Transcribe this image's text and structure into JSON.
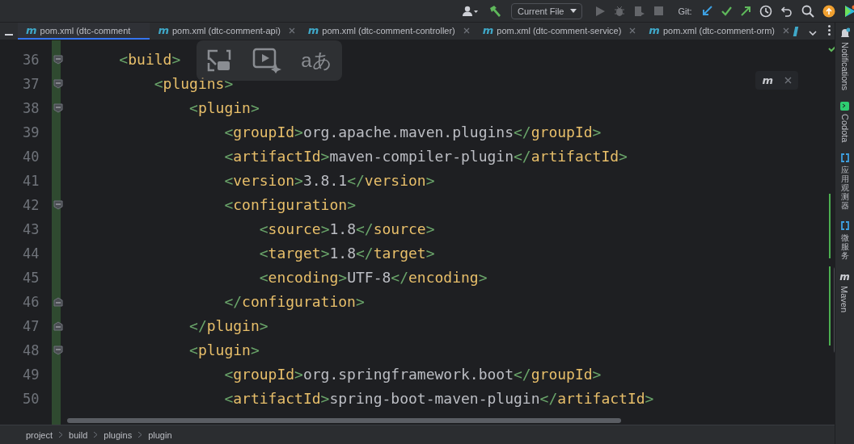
{
  "toolbar": {
    "run_config": "Current File",
    "run_actions_disabled": true,
    "git_label": "Git:"
  },
  "tabs": [
    {
      "icon": "m",
      "label": "pom.xml (dtc-comment",
      "selected": true
    },
    {
      "icon": "m",
      "label": "pom.xml (dtc-comment-api)",
      "selected": false
    },
    {
      "icon": "m",
      "label": "pom.xml (dtc-comment-controller)",
      "selected": false
    },
    {
      "icon": "m",
      "label": "pom.xml (dtc-comment-service)",
      "selected": false
    },
    {
      "icon": "m",
      "label": "pom.xml (dtc-comment-orm)",
      "selected": false
    }
  ],
  "overlay": {
    "translate_glyph": "aあ"
  },
  "maven_popup": {
    "icon": "m"
  },
  "editor": {
    "lines": [
      {
        "number": "36",
        "code": "    <build>",
        "fold_open": true,
        "fold_close": false
      },
      {
        "number": "37",
        "code": "        <plugins>",
        "fold_open": true,
        "fold_close": false
      },
      {
        "number": "38",
        "code": "            <plugin>",
        "fold_open": true,
        "fold_close": false
      },
      {
        "number": "39",
        "code": "                <groupId>org.apache.maven.plugins</groupId>",
        "fold_open": false,
        "fold_close": false
      },
      {
        "number": "40",
        "code": "                <artifactId>maven-compiler-plugin</artifactId>",
        "fold_open": false,
        "fold_close": false
      },
      {
        "number": "41",
        "code": "                <version>3.8.1</version>",
        "fold_open": false,
        "fold_close": false
      },
      {
        "number": "42",
        "code": "                <configuration>",
        "fold_open": true,
        "fold_close": false
      },
      {
        "number": "43",
        "code": "                    <source>1.8</source>",
        "fold_open": false,
        "fold_close": false
      },
      {
        "number": "44",
        "code": "                    <target>1.8</target>",
        "fold_open": false,
        "fold_close": false
      },
      {
        "number": "45",
        "code": "                    <encoding>UTF-8</encoding>",
        "fold_open": false,
        "fold_close": false
      },
      {
        "number": "46",
        "code": "                </configuration>",
        "fold_open": false,
        "fold_close": true
      },
      {
        "number": "47",
        "code": "            </plugin>",
        "fold_open": false,
        "fold_close": true
      },
      {
        "number": "48",
        "code": "            <plugin>",
        "fold_open": true,
        "fold_close": false
      },
      {
        "number": "49",
        "code": "                <groupId>org.springframework.boot</groupId>",
        "fold_open": false,
        "fold_close": false
      },
      {
        "number": "50",
        "code": "                <artifactId>spring-boot-maven-plugin</artifactId>",
        "fold_open": false,
        "fold_close": false
      }
    ]
  },
  "side_strip": [
    {
      "kind": "latin",
      "label": "Notifications"
    },
    {
      "kind": "latin",
      "label": "Codota"
    },
    {
      "kind": "cjk",
      "label": "应用观测器"
    },
    {
      "kind": "cjk",
      "label": "微服务"
    },
    {
      "kind": "latin",
      "label": "Maven",
      "icon": "m"
    }
  ],
  "breadcrumb": [
    "project",
    "build",
    "plugins",
    "plugin"
  ]
}
